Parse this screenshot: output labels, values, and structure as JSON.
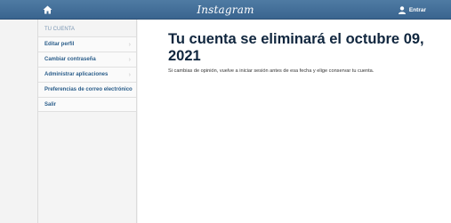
{
  "header": {
    "brand": "Instagram",
    "login_label": "Entrar",
    "icons": {
      "home": "home-icon",
      "user": "user-icon"
    }
  },
  "sidebar": {
    "heading": "TU CUENTA",
    "items": [
      {
        "label": "Editar perfil",
        "chevron": true
      },
      {
        "label": "Cambiar contraseña",
        "chevron": true
      },
      {
        "label": "Administrar aplicaciones",
        "chevron": true
      },
      {
        "label": "Preferencias de correo electrónico",
        "chevron": false
      },
      {
        "label": "Salir",
        "chevron": false
      }
    ]
  },
  "main": {
    "title": "Tu cuenta se eliminará el octubre 09, 2021",
    "description": "Si cambias de opinión, vuelve a iniciar sesión antes de esa fecha y elige conservar tu cuenta."
  },
  "colors": {
    "topbar": "#3f6a95",
    "link": "#2a5d8a",
    "title": "#10263e"
  }
}
